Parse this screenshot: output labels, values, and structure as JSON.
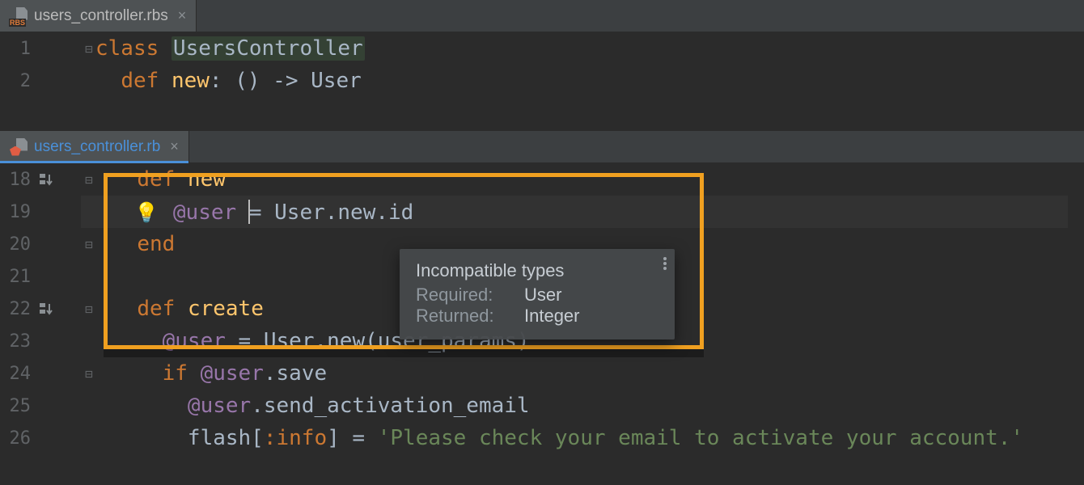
{
  "pane_top": {
    "tab": {
      "filename": "users_controller.rbs",
      "icon": "rbs-file-icon"
    },
    "lines": [
      {
        "num": "1",
        "fold": "⊟",
        "tokens": [
          {
            "t": "class ",
            "c": "kw"
          },
          {
            "t": "UsersController",
            "c": "cname decl-bg"
          }
        ]
      },
      {
        "num": "2",
        "fold": "",
        "tokens": [
          {
            "t": "  ",
            "c": ""
          },
          {
            "t": "def ",
            "c": "kw"
          },
          {
            "t": "new",
            "c": "mname"
          },
          {
            "t": ": () -> User",
            "c": "op"
          }
        ]
      }
    ]
  },
  "pane_bottom": {
    "tab": {
      "filename": "users_controller.rb",
      "icon": "rb-file-icon"
    },
    "lines": [
      {
        "num": "18",
        "nav": true,
        "fold": "⊟",
        "tokens": [
          {
            "t": "  ",
            "c": ""
          },
          {
            "t": "def ",
            "c": "kw"
          },
          {
            "t": "new",
            "c": "mname"
          }
        ]
      },
      {
        "num": "19",
        "bulb": true,
        "caret": true,
        "tokens": [
          {
            "t": "@user",
            "c": "ivar"
          },
          {
            "t": " ",
            "c": ""
          },
          {
            "caret": true
          },
          {
            "t": "= User.new.id",
            "c": "op"
          }
        ]
      },
      {
        "num": "20",
        "fold": "⊟",
        "tokens": [
          {
            "t": "  ",
            "c": ""
          },
          {
            "t": "end",
            "c": "kw"
          }
        ]
      },
      {
        "num": "21",
        "tokens": []
      },
      {
        "num": "22",
        "nav": true,
        "fold": "⊟",
        "tokens": [
          {
            "t": "  ",
            "c": ""
          },
          {
            "t": "def ",
            "c": "kw"
          },
          {
            "t": "create",
            "c": "mname"
          }
        ]
      },
      {
        "num": "23",
        "tokens": [
          {
            "t": "    ",
            "c": ""
          },
          {
            "t": "@user",
            "c": "ivar"
          },
          {
            "t": " = User.new(user_params)",
            "c": "op"
          }
        ]
      },
      {
        "num": "24",
        "fold": "⊟",
        "tokens": [
          {
            "t": "    ",
            "c": ""
          },
          {
            "t": "if ",
            "c": "kw"
          },
          {
            "t": "@user",
            "c": "ivar"
          },
          {
            "t": ".save",
            "c": "op"
          }
        ]
      },
      {
        "num": "25",
        "tokens": [
          {
            "t": "      ",
            "c": ""
          },
          {
            "t": "@user",
            "c": "ivar"
          },
          {
            "t": ".send_activation_email",
            "c": "op"
          }
        ]
      },
      {
        "num": "26",
        "tokens": [
          {
            "t": "      flash[",
            "c": "op"
          },
          {
            "t": ":info",
            "c": "kw"
          },
          {
            "t": "] = ",
            "c": "op"
          },
          {
            "t": "'Please check your email to activate your account.'",
            "c": "str"
          }
        ]
      }
    ]
  },
  "tooltip": {
    "title": "Incompatible types",
    "required_label": "Required:",
    "required_value": "User",
    "returned_label": "Returned:",
    "returned_value": "Integer"
  }
}
